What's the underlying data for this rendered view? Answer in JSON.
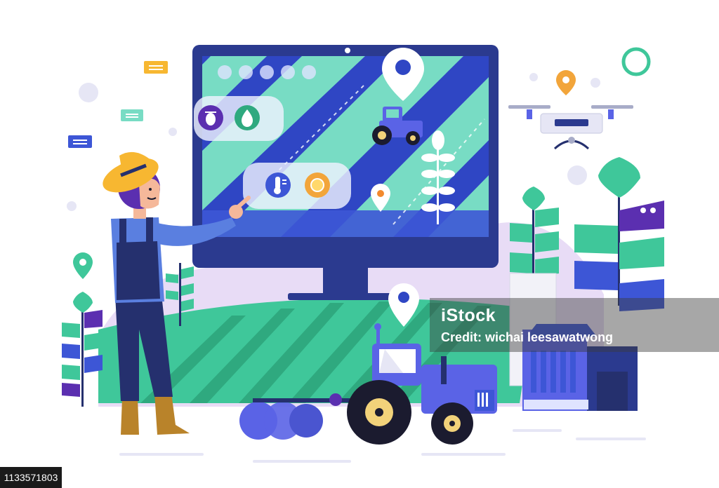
{
  "image": {
    "watermark_brand": "iStock",
    "watermark_credit": "Credit: wichai leesawatwong",
    "image_id": "1133571803"
  },
  "palette": {
    "screen_bg": "#2f46c4",
    "screen_stripe": "#78dcc4",
    "monitor_frame": "#2b3a8f",
    "field_green": "#3fc79a",
    "hill_purple": "#e8dcf6",
    "tractor_blue": "#5a63e6",
    "farmer_overalls": "#25306e",
    "hat_yellow": "#f7b731",
    "boots_brown": "#b9832a"
  },
  "icons": [
    "bug-icon",
    "water-drop-icon",
    "thermometer-icon",
    "sun-icon",
    "location-pin-icon",
    "drone-icon",
    "tractor-icon",
    "wheat-icon",
    "chat-bubble-icon"
  ]
}
